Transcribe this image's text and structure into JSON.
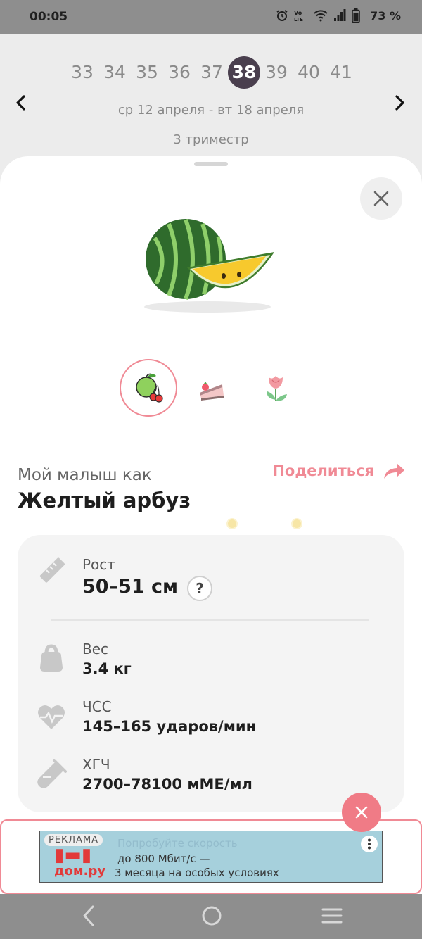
{
  "status_bar": {
    "time": "00:05",
    "battery": "73 %"
  },
  "week_nav": {
    "weeks": [
      "33",
      "34",
      "35",
      "36",
      "37",
      "38",
      "39",
      "40",
      "41"
    ],
    "active_week": "38",
    "date_range": "ср 12 апреля - вт 18 апреля",
    "trimester": "3 триместр"
  },
  "sheet": {
    "baby_as_label": "Мой малыш как",
    "baby_size_name": "Желтый арбуз",
    "share_label": "Поделиться",
    "categories": [
      "fruit-icon",
      "cake-icon",
      "flower-icon"
    ]
  },
  "stats": {
    "height": {
      "label": "Рост",
      "value": "50–51 см",
      "help": "?"
    },
    "weight": {
      "label": "Вес",
      "value": "3.4 кг"
    },
    "heart_rate": {
      "label": "ЧСС",
      "value": "145–165 ударов/мин"
    },
    "hcg": {
      "label": "ХГЧ",
      "value": "2700–78100 мМЕ/мл"
    }
  },
  "ad": {
    "tag": "РЕКЛАМА",
    "brand": "дом.ру",
    "line1": "Попробуйте скорость",
    "line2": "до 800 Мбит/с —",
    "line3": "3 месяца на особых условиях"
  },
  "colors": {
    "accent": "#f08a95",
    "active_week_bg": "#4a3f4e"
  }
}
